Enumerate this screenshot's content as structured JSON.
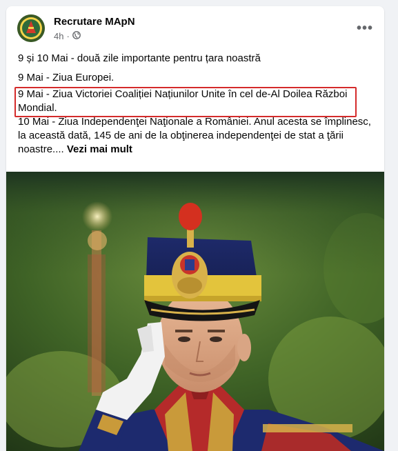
{
  "post": {
    "author": "Recrutare MApN",
    "time": "4h",
    "dot": "·",
    "more_label": "•••",
    "lines": {
      "intro": "9 și 10 Mai - două zile importante pentru țara noastră",
      "europe_day": "9 Mai - Ziua Europei.",
      "victory_day": "9 Mai - Ziua Victoriei Coaliției Națiunilor Unite în cel de-Al Doilea Război Mondial.",
      "independence_day": "10 Mai - Ziua Independenţei Naţionale a României. Anul acesta se împlinesc, la această dată, 145 de ani de la obţinerea independenţei de stat a ţării noastre....",
      "see_more": "Vezi mai mult"
    },
    "highlight_color": "#d42a2a",
    "icons": {
      "privacy": "globe-icon",
      "more": "more-options-icon"
    }
  }
}
